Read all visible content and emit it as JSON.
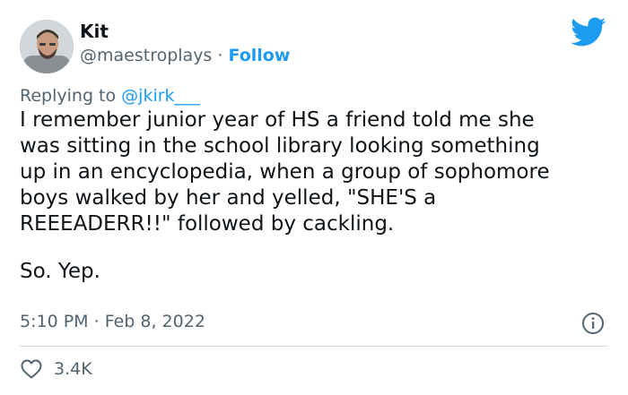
{
  "author": {
    "name": "Kit",
    "handle": "@maestroplays",
    "separator": "·",
    "follow_label": "Follow",
    "avatar_icon": "profile-photo-icon"
  },
  "platform_icon": "twitter-bird-icon",
  "reply": {
    "prefix": "Replying to",
    "mention": "@jkirk___"
  },
  "tweet": {
    "paragraph_1": "I remember junior year of HS a friend told me she\nwas sitting in the school library looking something\nup in an encyclopedia, when a group of sophomore\nboys walked by her and yelled, \"SHE'S a\nREEEADERR!!\" followed by cackling.",
    "paragraph_2": "So. Yep."
  },
  "meta": {
    "time": "5:10 PM",
    "separator": "·",
    "date": "Feb 8, 2022",
    "info_icon": "info-icon"
  },
  "engagement": {
    "likes": "3.4K",
    "like_icon": "heart-icon"
  },
  "colors": {
    "accent": "#1d9bf0",
    "secondary_text": "#536471",
    "primary_text": "#0f1419",
    "divider": "#cfd9de"
  }
}
